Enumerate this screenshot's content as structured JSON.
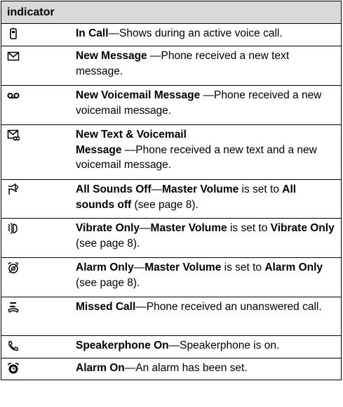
{
  "header": {
    "title": "indicator"
  },
  "rows": [
    {
      "icon": "in-call-icon",
      "term": "In Call",
      "sep": "—",
      "text": "Shows during an active voice call."
    },
    {
      "icon": "new-message-icon",
      "term": "New Message",
      "sep": " —",
      "text": "Phone received a new text message."
    },
    {
      "icon": "voicemail-icon",
      "term": "New Voicemail Message",
      "sep": " —",
      "text": "Phone received a new voicemail message."
    },
    {
      "icon": "text-voicemail-icon",
      "term_line1": "New Text & Voicemail",
      "term_line2": "Message",
      "sep": " —",
      "text": "Phone received a new text and a new voicemail message."
    },
    {
      "icon": "all-sounds-off-icon",
      "term": "All Sounds Off",
      "sep": "—",
      "setting": "Master Volume",
      "mid": " is set to ",
      "value": "All sounds off",
      "tail": " (see page 8)."
    },
    {
      "icon": "vibrate-only-icon",
      "term": "Vibrate Only",
      "sep": "—",
      "setting": "Master Volume",
      "mid": " is set to ",
      "value": "Vibrate Only",
      "tail": " (see page 8)."
    },
    {
      "icon": "alarm-only-icon",
      "term": "Alarm Only",
      "sep": "—",
      "setting": "Master Volume",
      "mid": " is set to ",
      "value": "Alarm Only",
      "tail": " (see page 8)."
    },
    {
      "icon": "missed-call-icon",
      "term": "Missed Call",
      "sep": "—",
      "text": "Phone received an unanswered call."
    },
    {
      "icon": "speakerphone-icon",
      "term": "Speakerphone On",
      "sep": "—",
      "text": "Speakerphone is on."
    },
    {
      "icon": "alarm-on-icon",
      "term": "Alarm On",
      "sep": "—",
      "text": "An alarm has been set."
    }
  ]
}
